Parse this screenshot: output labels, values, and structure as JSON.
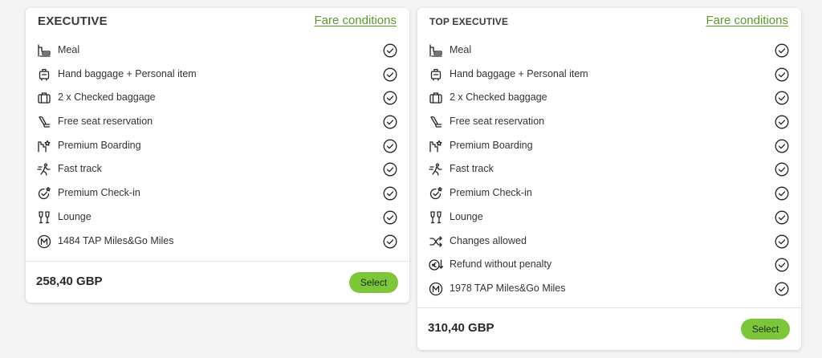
{
  "cards": [
    {
      "title": "EXECUTIVE",
      "fare_conditions_label": "Fare conditions",
      "features": [
        {
          "label": "Meal",
          "icon": "meal-icon",
          "included": true
        },
        {
          "label": "Hand baggage + Personal item",
          "icon": "hand-baggage-icon",
          "included": true
        },
        {
          "label": "2 x Checked baggage",
          "icon": "checked-baggage-icon",
          "included": true
        },
        {
          "label": "Free seat reservation",
          "icon": "seat-icon",
          "included": true
        },
        {
          "label": "Premium Boarding",
          "icon": "premium-boarding-icon",
          "included": true
        },
        {
          "label": "Fast track",
          "icon": "fast-track-icon",
          "included": true
        },
        {
          "label": "Premium Check-in",
          "icon": "premium-checkin-icon",
          "included": true
        },
        {
          "label": "Lounge",
          "icon": "lounge-icon",
          "included": true
        },
        {
          "label": "1484 TAP Miles&Go Miles",
          "icon": "miles-icon",
          "included": true
        }
      ],
      "price": "258,40 GBP",
      "select_label": "Select"
    },
    {
      "title": "TOP EXECUTIVE",
      "fare_conditions_label": "Fare conditions",
      "features": [
        {
          "label": "Meal",
          "icon": "meal-icon",
          "included": true
        },
        {
          "label": "Hand baggage + Personal item",
          "icon": "hand-baggage-icon",
          "included": true
        },
        {
          "label": "2 x Checked baggage",
          "icon": "checked-baggage-icon",
          "included": true
        },
        {
          "label": "Free seat reservation",
          "icon": "seat-icon",
          "included": true
        },
        {
          "label": "Premium Boarding",
          "icon": "premium-boarding-icon",
          "included": true
        },
        {
          "label": "Fast track",
          "icon": "fast-track-icon",
          "included": true
        },
        {
          "label": "Premium Check-in",
          "icon": "premium-checkin-icon",
          "included": true
        },
        {
          "label": "Lounge",
          "icon": "lounge-icon",
          "included": true
        },
        {
          "label": "Changes allowed",
          "icon": "shuffle-icon",
          "included": true
        },
        {
          "label": "Refund without penalty",
          "icon": "refund-icon",
          "included": true
        },
        {
          "label": "1978 TAP Miles&Go Miles",
          "icon": "miles-icon",
          "included": true
        }
      ],
      "price": "310,40 GBP",
      "select_label": "Select"
    }
  ],
  "colors": {
    "accent_green": "#7cc63a",
    "link_green": "#5a9a2a",
    "card_background": "#ffffff",
    "page_background": "#f4f4f4"
  }
}
